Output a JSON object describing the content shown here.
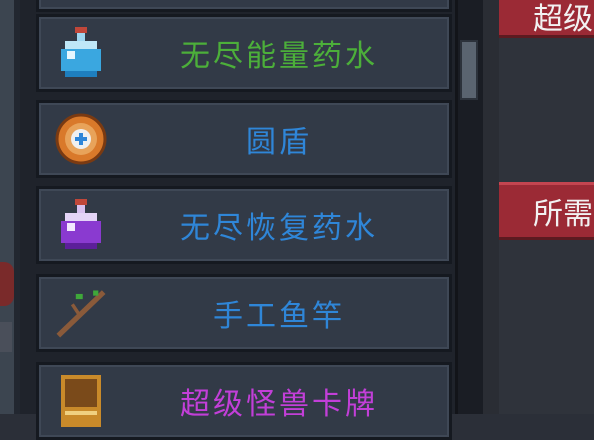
{
  "inventory": {
    "items": [
      {
        "name": "",
        "color": "#3fa83a",
        "icon": "potion-blue-icon"
      },
      {
        "name": "无尽能量药水",
        "color": "#4caf3a",
        "icon": "potion-blue-icon"
      },
      {
        "name": "圆盾",
        "color": "#2f86d8",
        "icon": "round-shield-icon"
      },
      {
        "name": "无尽恢复药水",
        "color": "#2f86d8",
        "icon": "potion-purple-icon"
      },
      {
        "name": "手工鱼竿",
        "color": "#2f86d8",
        "icon": "fishing-rod-icon"
      },
      {
        "name": "超级怪兽卡牌",
        "color": "#c23fd8",
        "icon": "monster-card-icon"
      }
    ]
  },
  "right_tabs": {
    "top_label": "超级",
    "middle_label": "所需"
  },
  "colors": {
    "tab_red": "#9b2a35",
    "panel_bg": "#1f232b",
    "item_bg": "#323a47"
  }
}
